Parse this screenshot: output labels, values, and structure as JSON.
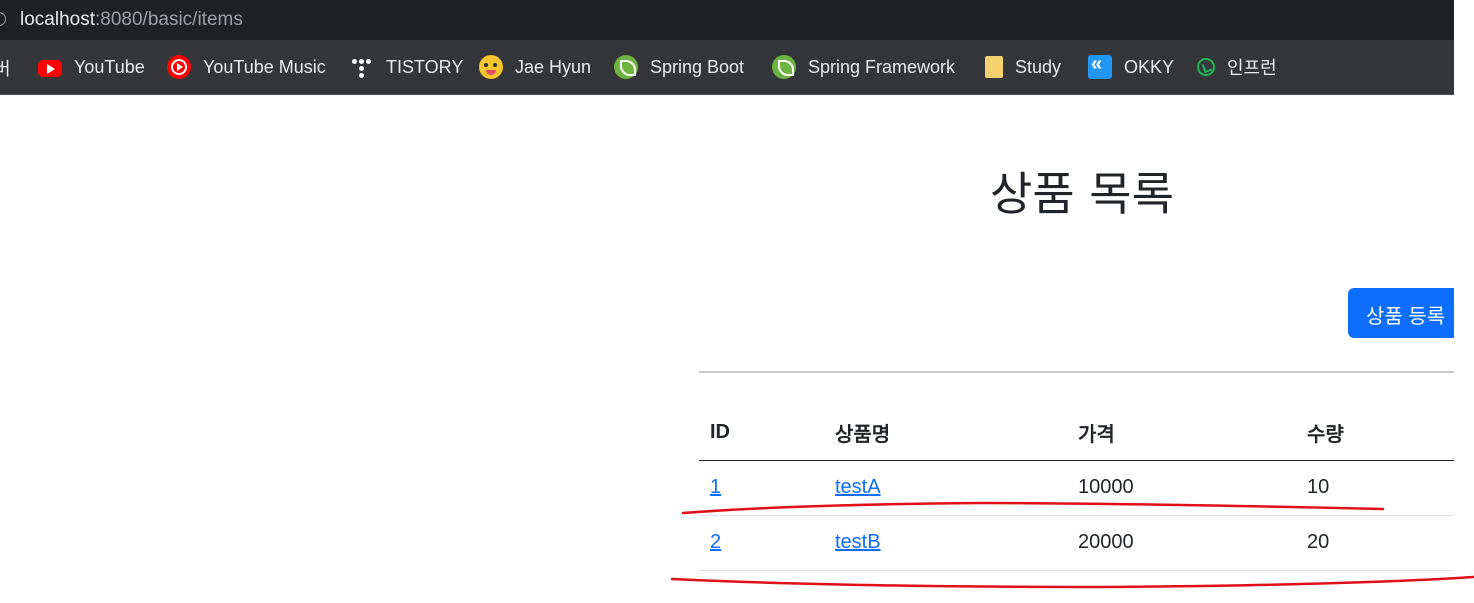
{
  "browser": {
    "url_host": "localhost",
    "url_path": ":8080/basic/items"
  },
  "bookmarks": {
    "partial_label": "버",
    "items": [
      {
        "label": "YouTube",
        "icon": "youtube-icon"
      },
      {
        "label": "YouTube Music",
        "icon": "youtube-music-icon"
      },
      {
        "label": "TISTORY",
        "icon": "tistory-icon"
      },
      {
        "label": "Jae Hyun",
        "icon": "emoji-face-icon"
      },
      {
        "label": "Spring Boot",
        "icon": "spring-icon"
      },
      {
        "label": "Spring Framework",
        "icon": "spring-icon"
      },
      {
        "label": "Study",
        "icon": "folder-icon"
      },
      {
        "label": "OKKY",
        "icon": "okky-icon"
      },
      {
        "label": "인프런",
        "icon": "inflearn-icon"
      }
    ]
  },
  "page": {
    "title": "상품 목록",
    "register_button": "상품 등록"
  },
  "table": {
    "headers": [
      "ID",
      "상품명",
      "가격",
      "수량"
    ],
    "rows": [
      {
        "id": "1",
        "name": "testA",
        "price": "10000",
        "quantity": "10"
      },
      {
        "id": "2",
        "name": "testB",
        "price": "20000",
        "quantity": "20"
      }
    ]
  },
  "colors": {
    "primary": "#0d6efd",
    "annotation": "#e0101a"
  }
}
